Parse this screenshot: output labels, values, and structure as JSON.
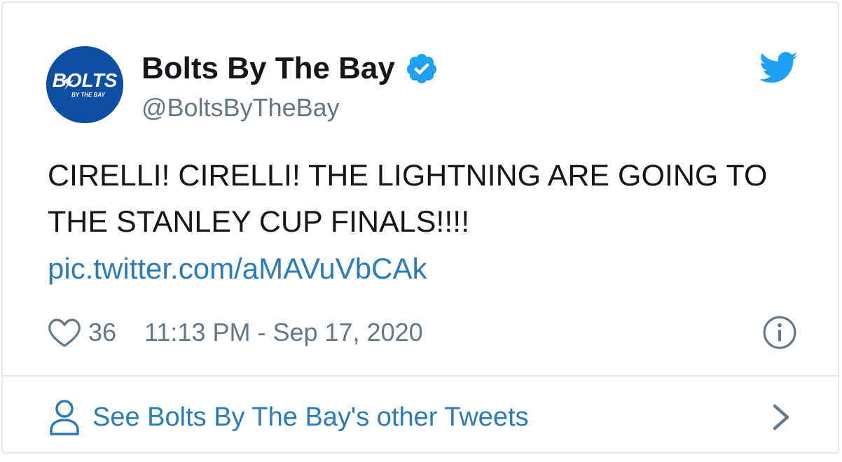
{
  "account": {
    "display_name": "Bolts By The Bay",
    "handle": "@BoltsByTheBay",
    "avatar_text": "BOLTS",
    "avatar_subtext": "BY THE BAY",
    "verified": true
  },
  "tweet": {
    "text": "CIRELLI! CIRELLI! THE LIGHTNING ARE GOING TO THE STANLEY CUP FINALS!!!!",
    "link": "pic.twitter.com/aMAVuVbCAk",
    "likes": "36",
    "timestamp": "11:13 PM - Sep 17, 2020"
  },
  "footer": {
    "label": "See Bolts By The Bay's other Tweets"
  },
  "icons": {
    "brand": "twitter-bird-icon",
    "like": "heart-icon",
    "info": "info-icon",
    "profile": "person-icon",
    "more": "chevron-right-icon"
  },
  "colors": {
    "link": "#2b7bb9",
    "twitter_blue": "#1da1f2",
    "avatar_bg": "#0b4ea2",
    "muted": "#657786",
    "text": "#14171a"
  }
}
